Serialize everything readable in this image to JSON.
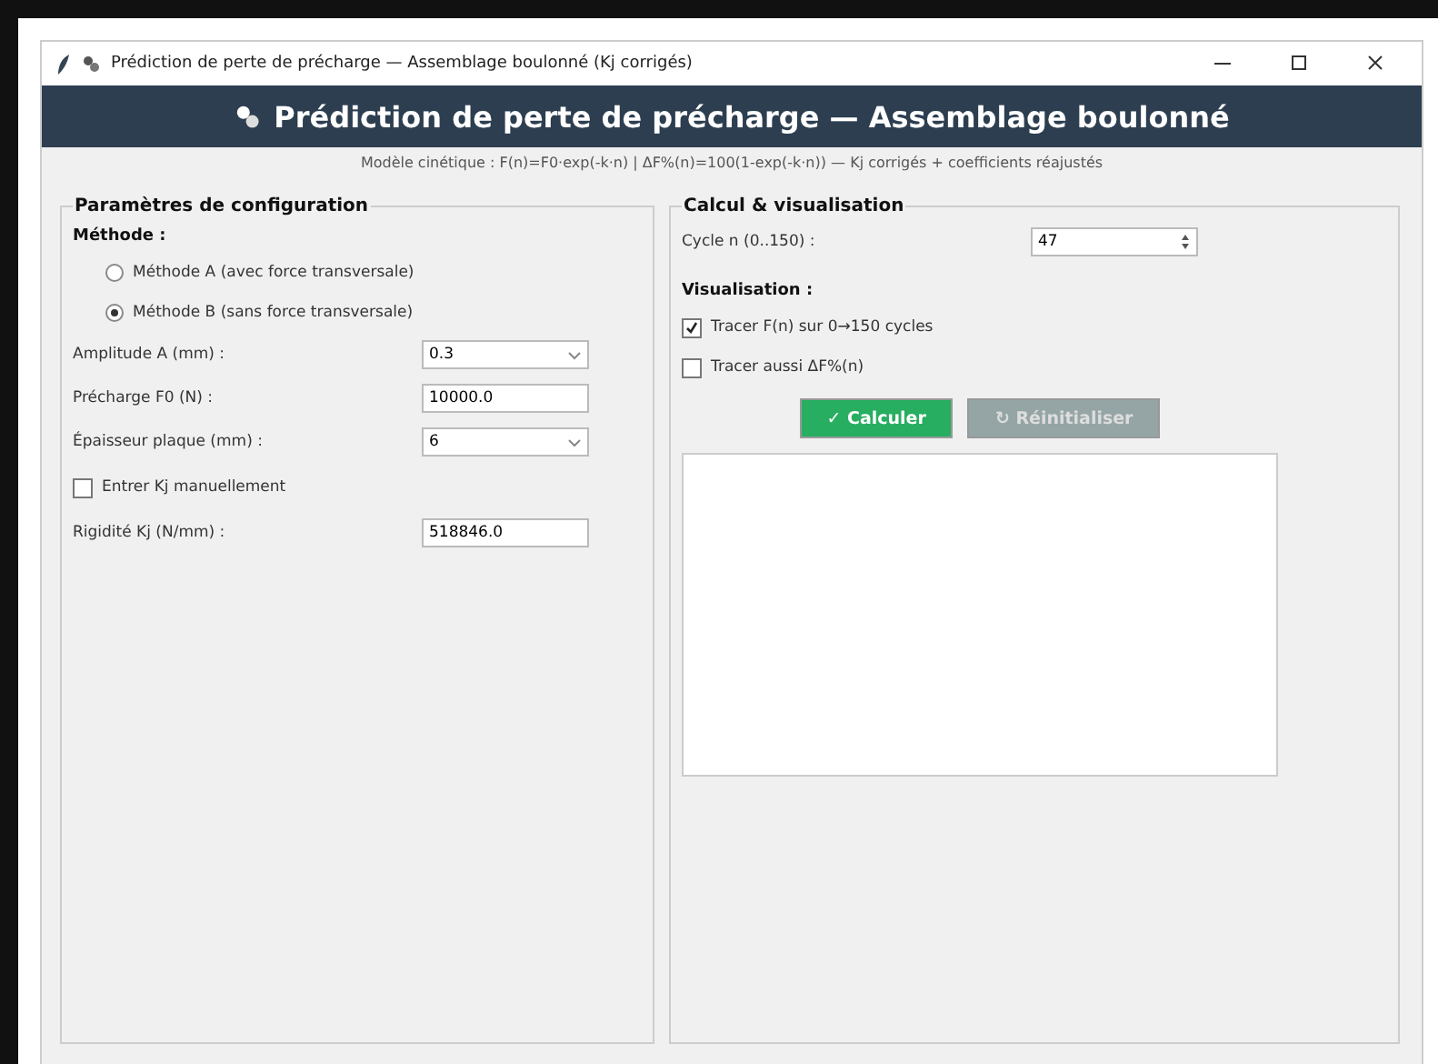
{
  "window": {
    "title": "Prédiction de perte de précharge — Assemblage boulonné (Kj corrigés)"
  },
  "header": {
    "title": "Prédiction de perte de précharge — Assemblage boulonné",
    "subtitle": "Modèle cinétique : F(n)=F0·exp(-k·n) | ΔF%(n)=100(1-exp(-k·n))  —  Kj corrigés + coefficients réajustés"
  },
  "config": {
    "title": "Paramètres de configuration",
    "method_label": "Méthode :",
    "methods": [
      {
        "label": "Méthode A (avec force transversale)",
        "selected": false
      },
      {
        "label": "Méthode B (sans force transversale)",
        "selected": true
      }
    ],
    "fields": [
      {
        "kind": "combo",
        "label": "Amplitude A (mm) :",
        "value": "0.3"
      },
      {
        "kind": "entry",
        "label": "Précharge F0 (N) :",
        "value": "10000.0"
      },
      {
        "kind": "combo",
        "label": "Épaisseur plaque (mm) :",
        "value": "6"
      },
      {
        "kind": "check",
        "label": "Entrer Kj manuellement",
        "checked": false
      },
      {
        "kind": "entry",
        "label": "Rigidité Kj (N/mm) :",
        "value": "518846.0"
      }
    ]
  },
  "calc": {
    "title": "Calcul & visualisation",
    "cycle_label": "Cycle n (0..150) :",
    "cycle_value": "47",
    "vis_label": "Visualisation :",
    "options": [
      {
        "label": "Tracer F(n) sur 0→150 cycles",
        "checked": true
      },
      {
        "label": "Tracer aussi ΔF%(n)",
        "checked": false
      }
    ],
    "buttons": [
      {
        "label": "✓ Calculer",
        "disabled": false,
        "kind": "primary"
      },
      {
        "label": "↻ Réinitialiser",
        "disabled": true,
        "kind": "secondary"
      }
    ]
  }
}
